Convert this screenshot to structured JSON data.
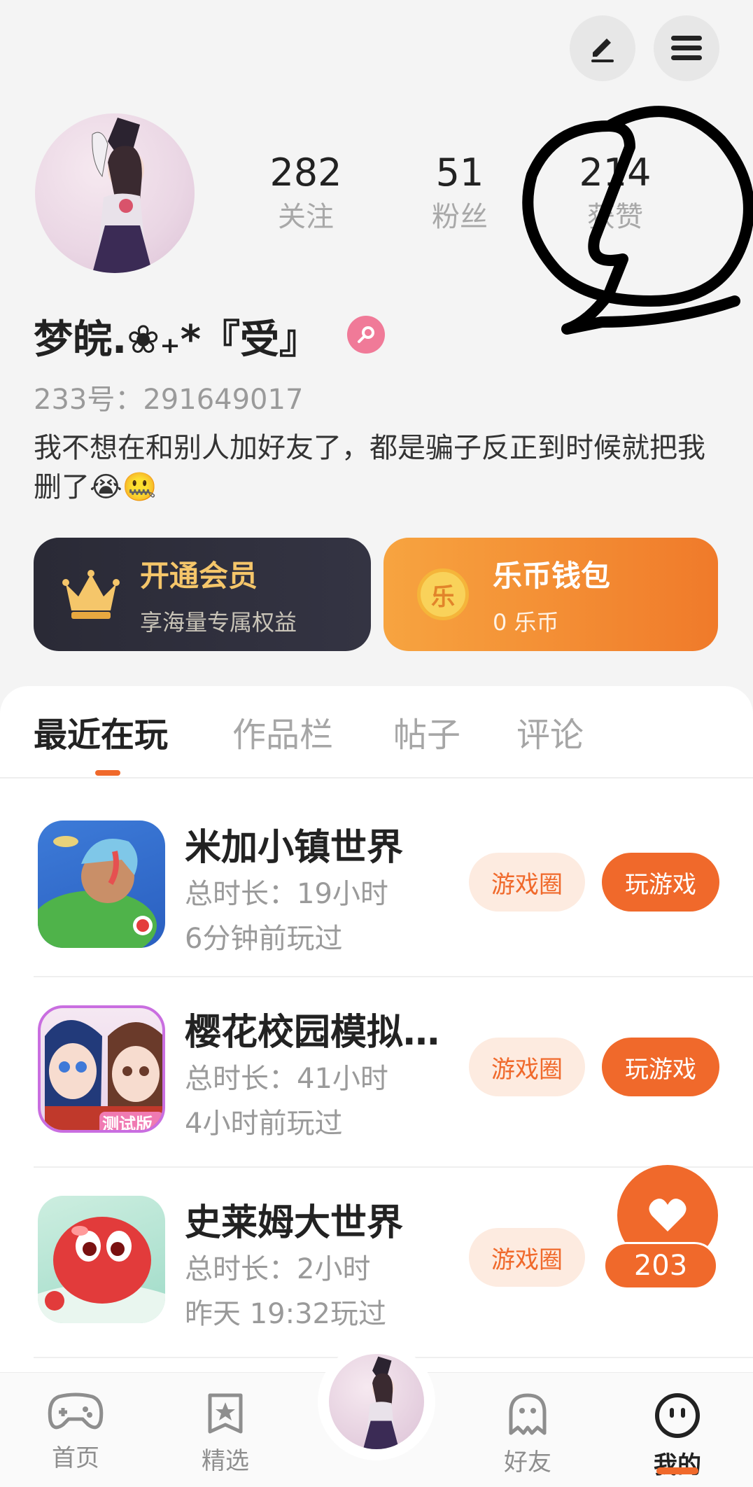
{
  "header": {
    "edit_icon": "pencil-icon",
    "menu_icon": "hamburger-icon"
  },
  "profile": {
    "stats": [
      {
        "value": "282",
        "label": "关注"
      },
      {
        "value": "51",
        "label": "粉丝"
      },
      {
        "value": "214",
        "label": "获赞"
      }
    ],
    "name": "梦皖.❀₊*『受』",
    "gender_icon": "female-icon",
    "id_text": "233号：291649017",
    "bio": "我不想在和别人加好友了，都是骗子反正到时候就把我删了😭🤐"
  },
  "cards": {
    "vip": {
      "title": "开通会员",
      "subtitle": "享海量专属权益",
      "icon": "crown-icon"
    },
    "wallet": {
      "title": "乐币钱包",
      "subtitle": "0 乐币",
      "icon_text": "乐"
    }
  },
  "tabs": [
    {
      "label": "最近在玩",
      "active": true
    },
    {
      "label": "作品栏",
      "active": false
    },
    {
      "label": "帖子",
      "active": false
    },
    {
      "label": "评论",
      "active": false
    }
  ],
  "games": [
    {
      "name": "米加小镇世界",
      "duration": "总时长：19小时",
      "last_played": "6分钟前玩过",
      "circle_label": "游戏圈",
      "play_label": "玩游戏"
    },
    {
      "name": "樱花校园模拟…",
      "duration": "总时长：41小时",
      "last_played": "4小时前玩过",
      "circle_label": "游戏圈",
      "play_label": "玩游戏",
      "badge": "测试版"
    },
    {
      "name": "史莱姆大世界",
      "duration": "总时长：2小时",
      "last_played": "昨天 19:32玩过",
      "circle_label": "游戏圈"
    }
  ],
  "like_float": {
    "count": "203",
    "icon": "heart-icon"
  },
  "bottom_nav": [
    {
      "label": "首页",
      "icon": "gamepad-icon"
    },
    {
      "label": "精选",
      "icon": "star-icon"
    },
    {
      "label": "好友",
      "icon": "ghost-icon"
    },
    {
      "label": "我的",
      "icon": "face-icon",
      "active": true
    }
  ],
  "colors": {
    "accent": "#f0692b",
    "vip_bg": "#2a2a36",
    "wallet_bg": "#f39036",
    "vip_text": "#f5c66a"
  }
}
